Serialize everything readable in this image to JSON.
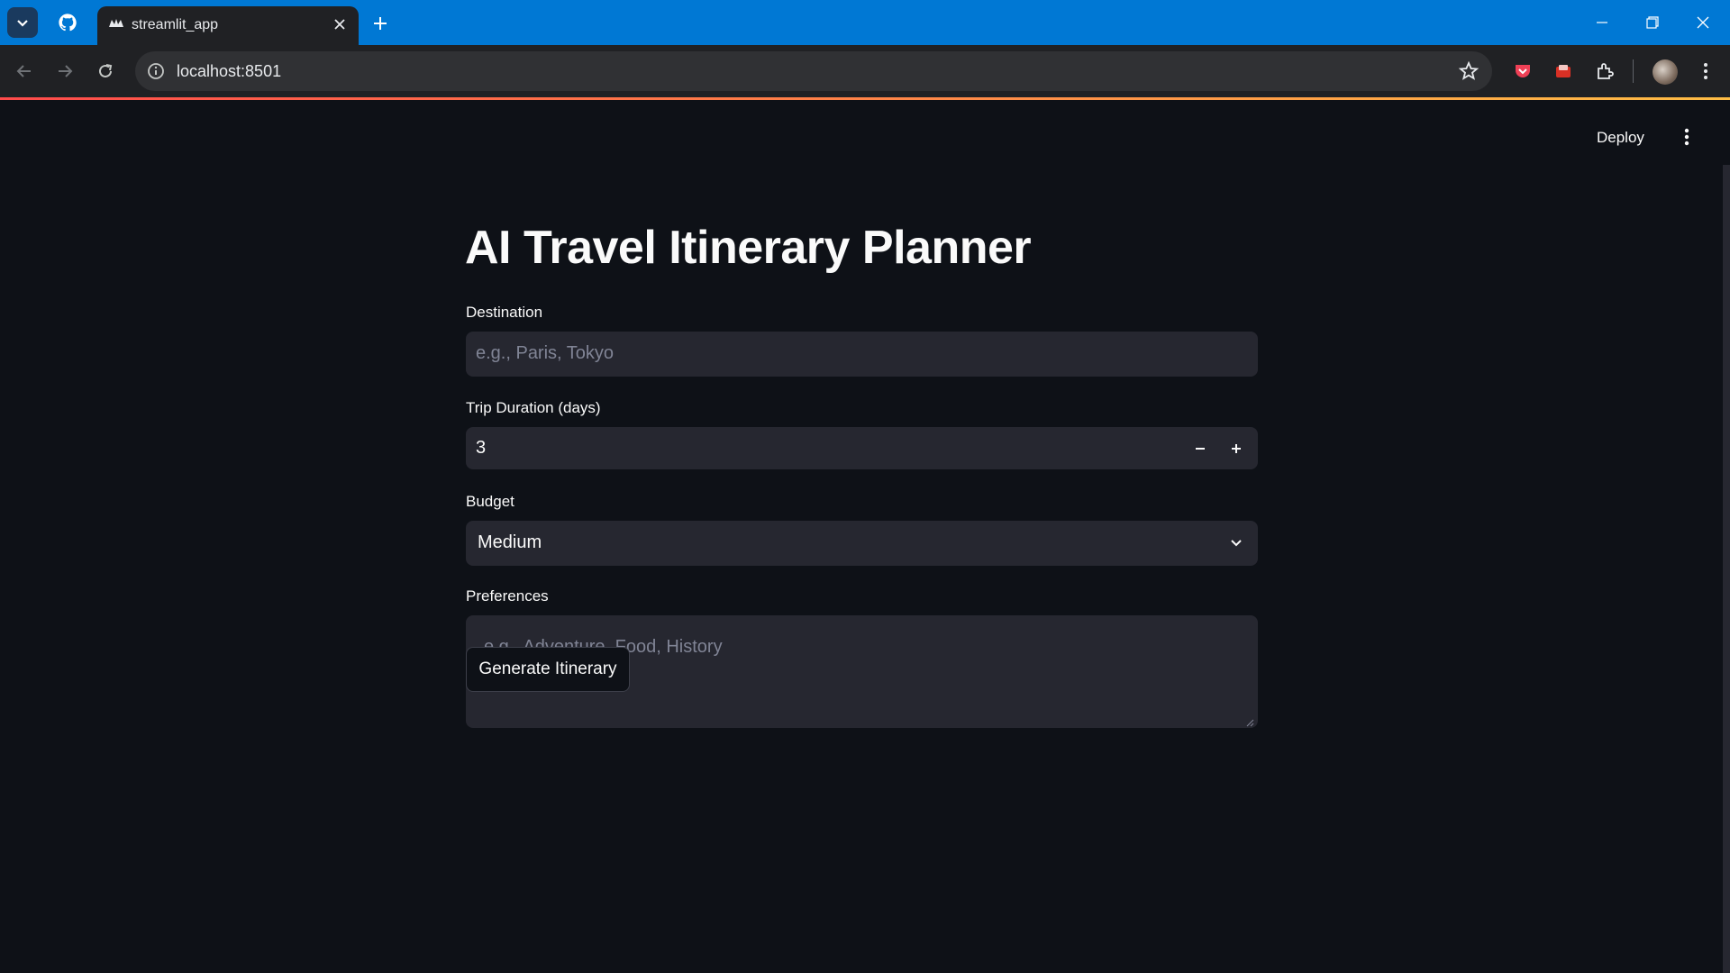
{
  "browser": {
    "tab_title": "streamlit_app",
    "url": "localhost:8501"
  },
  "app": {
    "deploy_label": "Deploy",
    "title": "AI Travel Itinerary Planner",
    "destination": {
      "label": "Destination",
      "placeholder": "e.g., Paris, Tokyo",
      "value": ""
    },
    "duration": {
      "label": "Trip Duration (days)",
      "value": "3"
    },
    "budget": {
      "label": "Budget",
      "selected": "Medium"
    },
    "preferences": {
      "label": "Preferences",
      "placeholder": "e.g., Adventure, Food, History",
      "value": ""
    },
    "generate_label": "Generate Itinerary"
  },
  "colors": {
    "titlebar": "#0078d4",
    "app_bg": "#0e1117",
    "field_bg": "#262730",
    "text": "#fafafa",
    "placeholder": "#808495",
    "accent_gradient_start": "#ff4b4b",
    "accent_gradient_end": "#ffbd45"
  },
  "icons": [
    "tab-search-icon",
    "github-icon",
    "streamlit-favicon-icon",
    "close-icon",
    "plus-icon",
    "minimize-icon",
    "restore-icon",
    "window-close-icon",
    "back-icon",
    "forward-icon",
    "reload-icon",
    "info-icon",
    "star-icon",
    "pocket-icon",
    "cast-icon",
    "extensions-icon",
    "more-vert-icon",
    "minus-icon",
    "chevron-down-icon"
  ]
}
